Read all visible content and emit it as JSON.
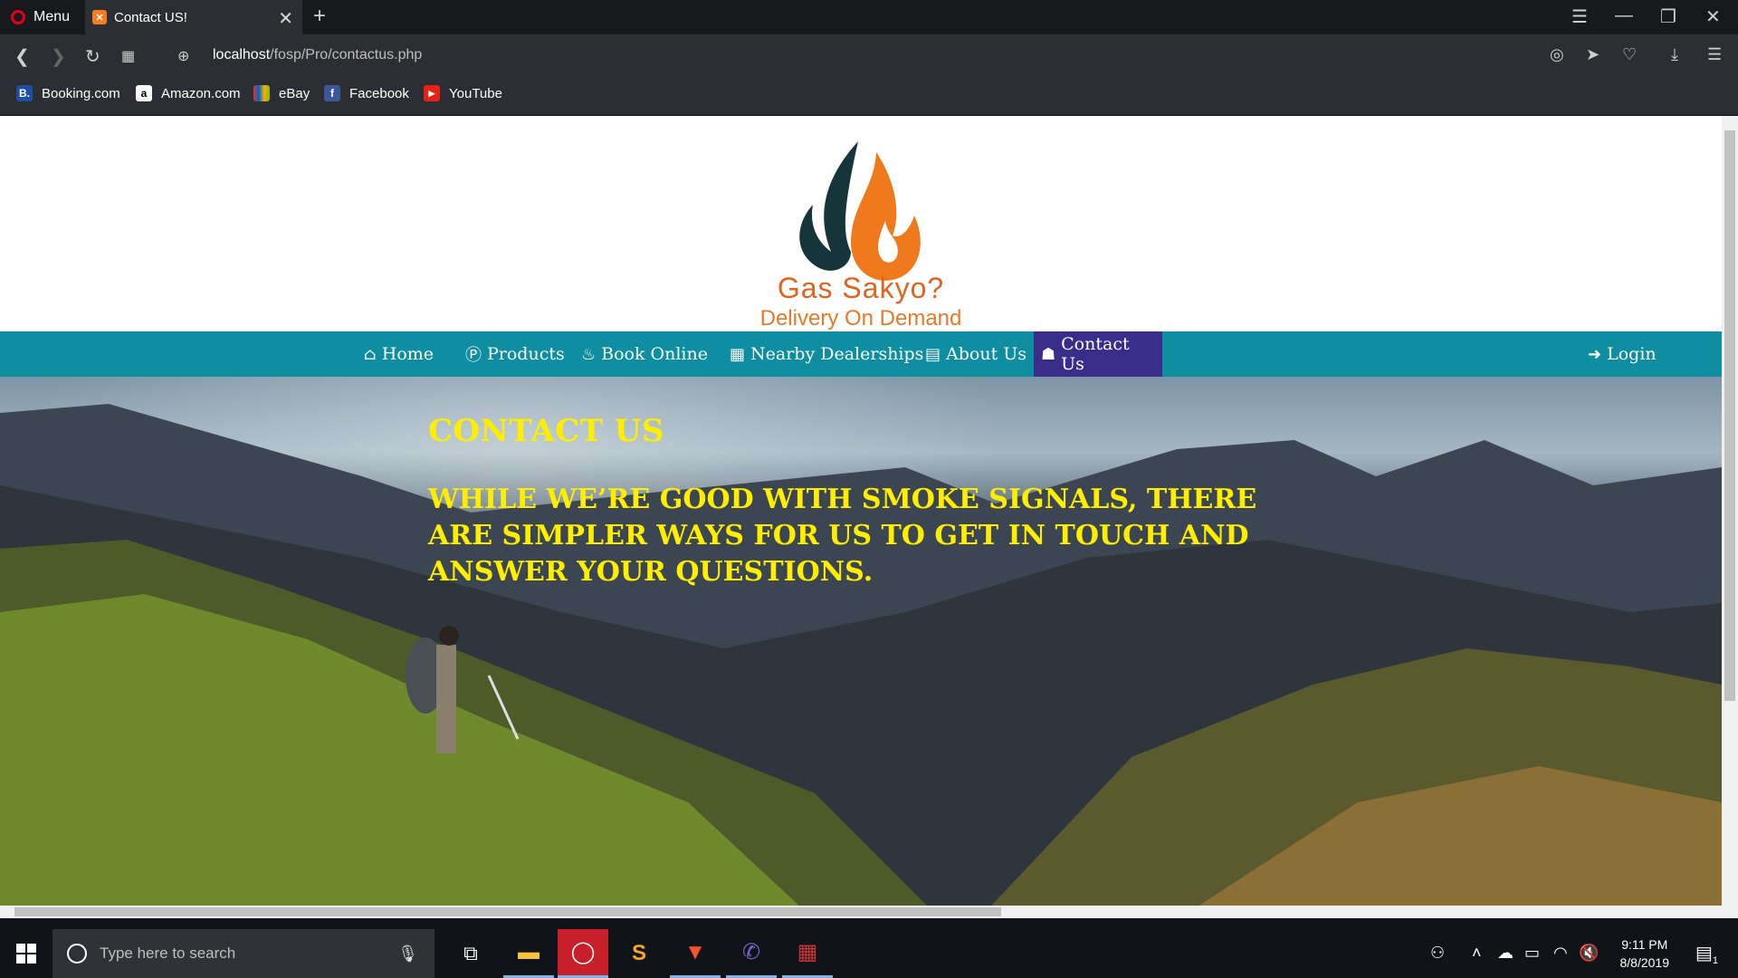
{
  "browser": {
    "menu_label": "Menu",
    "tab_title": "Contact US!",
    "url_host": "localhost",
    "url_path": "/fosp/Pro/contactus.php",
    "bookmarks": [
      "Booking.com",
      "Amazon.com",
      "eBay",
      "Facebook",
      "YouTube"
    ]
  },
  "site": {
    "brand_name": "Gas Sakyo?",
    "brand_tagline": "Delivery On Demand",
    "nav": {
      "home": "Home",
      "products": "Products",
      "book_online": "Book Online",
      "nearby_dealerships": "Nearby Dealerships",
      "about_us": "About Us",
      "contact_us": "Contact Us",
      "login": "Login"
    },
    "hero": {
      "title": "Contact Us",
      "text": "While we’re good with smoke signals, there are simpler ways for us to get in touch and answer your questions."
    },
    "colors": {
      "navbar": "#0e8ea0",
      "nav_active": "#3a2d8a",
      "hero_text": "#ffee00",
      "brand": "#e0641f"
    }
  },
  "taskbar": {
    "search_placeholder": "Type here to search",
    "time": "9:11 PM",
    "date": "8/8/2019",
    "notification_count": "1"
  }
}
